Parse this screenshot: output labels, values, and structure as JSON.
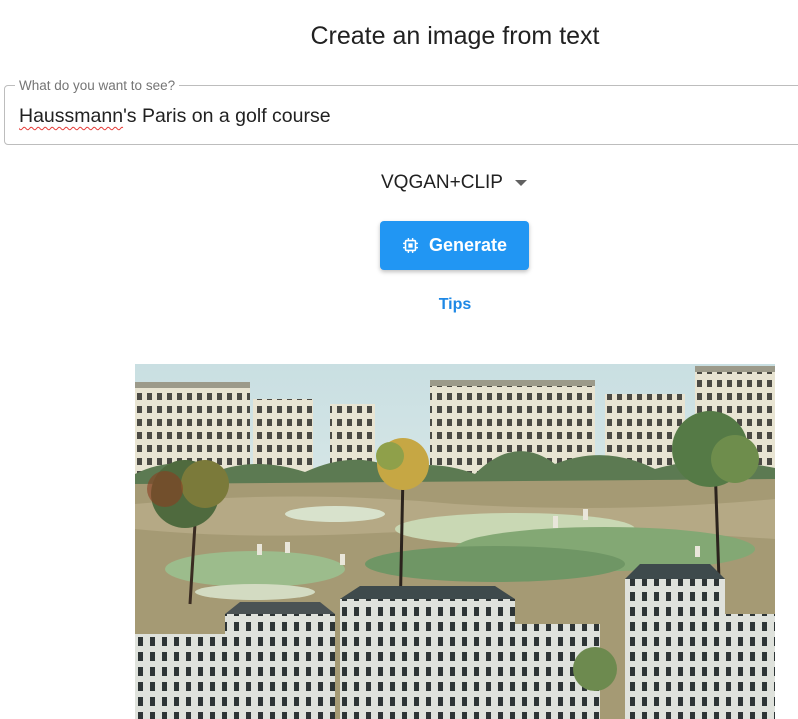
{
  "page": {
    "title": "Create an image from text"
  },
  "prompt": {
    "label": "What do you want to see?",
    "value_word1": "Haussmann",
    "value_rest": "'s Paris on a golf course"
  },
  "model_select": {
    "selected": "VQGAN+CLIP"
  },
  "generate_button": {
    "label": "Generate"
  },
  "tips_link": {
    "label": "Tips"
  },
  "colors": {
    "accent": "#2196f3",
    "link": "#1e88e5"
  },
  "icons": {
    "generate": "chip-icon",
    "dropdown": "triangle-down-icon"
  },
  "image": {
    "subject": "generated painting"
  }
}
